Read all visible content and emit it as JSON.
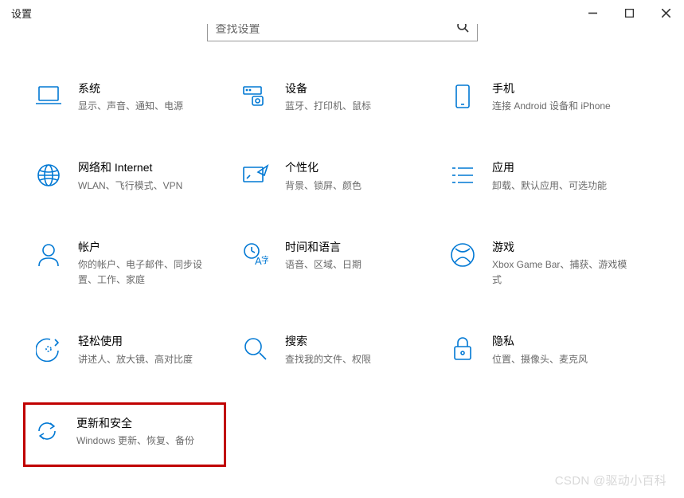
{
  "window": {
    "title": "设置"
  },
  "search": {
    "placeholder": "查找设置"
  },
  "tiles": {
    "system": {
      "title": "系统",
      "desc": "显示、声音、通知、电源"
    },
    "devices": {
      "title": "设备",
      "desc": "蓝牙、打印机、鼠标"
    },
    "phone": {
      "title": "手机",
      "desc": "连接 Android 设备和 iPhone"
    },
    "network": {
      "title": "网络和 Internet",
      "desc": "WLAN、飞行模式、VPN"
    },
    "personal": {
      "title": "个性化",
      "desc": "背景、锁屏、颜色"
    },
    "apps": {
      "title": "应用",
      "desc": "卸载、默认应用、可选功能"
    },
    "accounts": {
      "title": "帐户",
      "desc": "你的帐户、电子邮件、同步设置、工作、家庭"
    },
    "time": {
      "title": "时间和语言",
      "desc": "语音、区域、日期"
    },
    "gaming": {
      "title": "游戏",
      "desc": "Xbox Game Bar、捕获、游戏模式"
    },
    "ease": {
      "title": "轻松使用",
      "desc": "讲述人、放大镜、高对比度"
    },
    "search2": {
      "title": "搜索",
      "desc": "查找我的文件、权限"
    },
    "privacy": {
      "title": "隐私",
      "desc": "位置、摄像头、麦克风"
    },
    "update": {
      "title": "更新和安全",
      "desc": "Windows 更新、恢复、备份"
    }
  },
  "watermark": "CSDN @驱动小百科"
}
